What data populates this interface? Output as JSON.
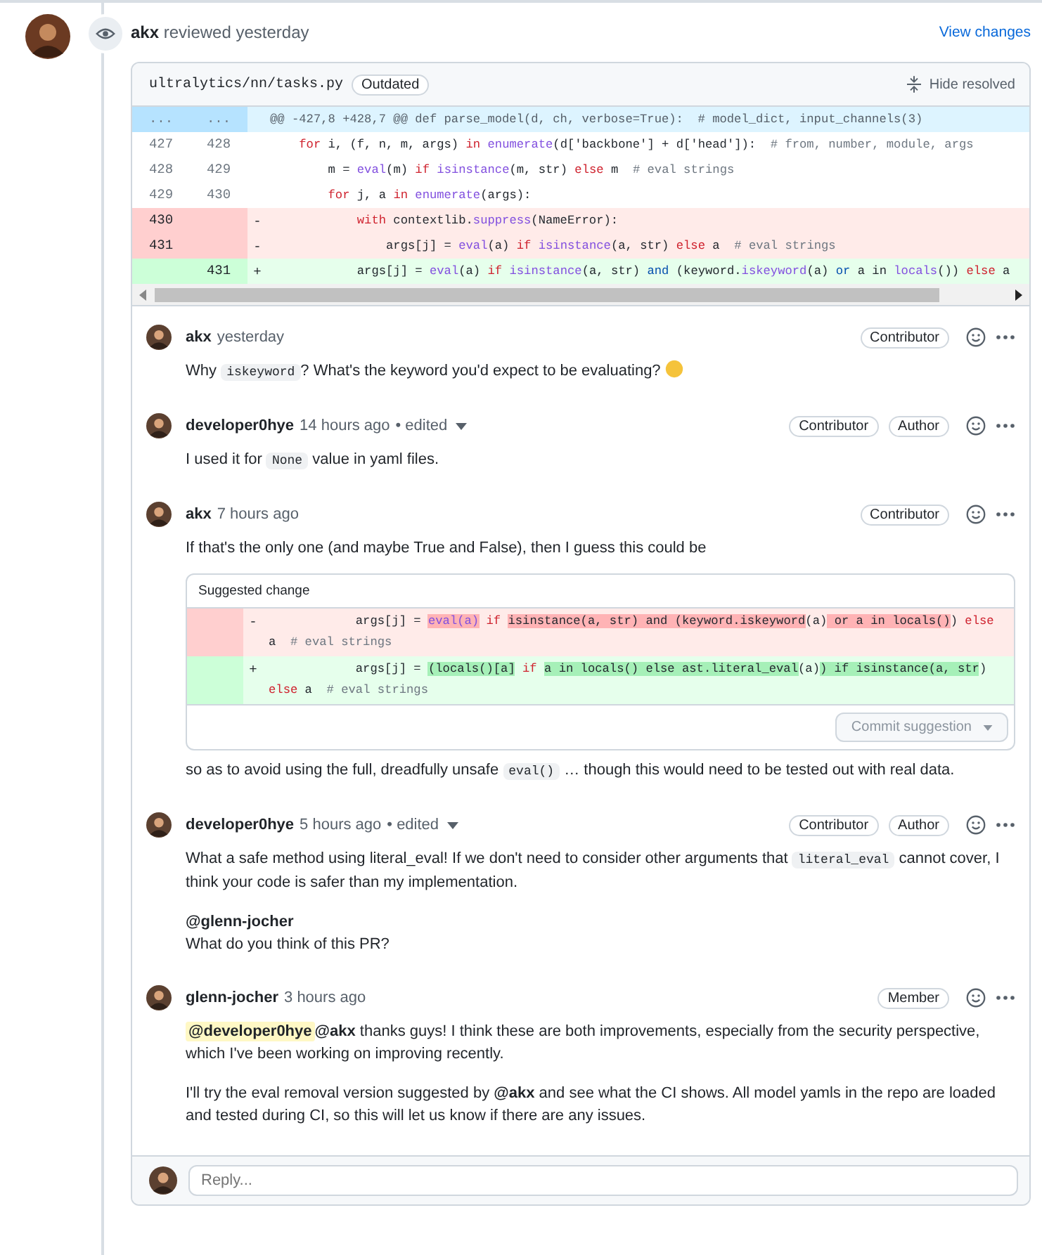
{
  "review": {
    "author": "akx",
    "action": "reviewed yesterday",
    "view_changes": "View changes"
  },
  "file": {
    "path": "ultralytics/nn/tasks.py",
    "badge": "Outdated",
    "hide_resolved": "Hide resolved"
  },
  "diff": [
    {
      "kind": "hunk",
      "old": "...",
      "new": "...",
      "tokens": [
        {
          "text": "@@ -427,8 +428,7 @@ def parse_model(d, ch, verbose=True):  # model_dict, input_channels(3)",
          "kind": "plain"
        }
      ]
    },
    {
      "kind": "context",
      "old": "427",
      "new": "428",
      "tokens": [
        {
          "text": "    for",
          "kind": "kw"
        },
        {
          "text": " i, (f, n, m, args) ",
          "kind": "plain"
        },
        {
          "text": "in ",
          "kind": "kw"
        },
        {
          "text": "enumerate",
          "kind": "fn"
        },
        {
          "text": "(d['backbone'] + d['head']):  ",
          "kind": "plain"
        },
        {
          "text": "# from, number, module, args",
          "kind": "cm"
        }
      ]
    },
    {
      "kind": "context",
      "old": "428",
      "new": "429",
      "tokens": [
        {
          "text": "        m = ",
          "kind": "plain"
        },
        {
          "text": "eval",
          "kind": "fn"
        },
        {
          "text": "(m) ",
          "kind": "plain"
        },
        {
          "text": "if ",
          "kind": "kw"
        },
        {
          "text": "isinstance",
          "kind": "fn"
        },
        {
          "text": "(m, str) ",
          "kind": "plain"
        },
        {
          "text": "else",
          "kind": "kw"
        },
        {
          "text": " m  ",
          "kind": "plain"
        },
        {
          "text": "# eval strings",
          "kind": "cm"
        }
      ]
    },
    {
      "kind": "context",
      "old": "429",
      "new": "430",
      "tokens": [
        {
          "text": "        for",
          "kind": "kw"
        },
        {
          "text": " j, a ",
          "kind": "plain"
        },
        {
          "text": "in ",
          "kind": "kw"
        },
        {
          "text": "enumerate",
          "kind": "fn"
        },
        {
          "text": "(args):",
          "kind": "plain"
        }
      ]
    },
    {
      "kind": "del",
      "old": "430",
      "sign": "-",
      "tokens": [
        {
          "text": "            with",
          "kind": "kw"
        },
        {
          "text": " contextlib.",
          "kind": "plain"
        },
        {
          "text": "suppress",
          "kind": "fn"
        },
        {
          "text": "(NameError):",
          "kind": "plain"
        }
      ]
    },
    {
      "kind": "del",
      "old": "431",
      "sign": "-",
      "tokens": [
        {
          "text": "                args[j] = ",
          "kind": "plain"
        },
        {
          "text": "eval",
          "kind": "fn"
        },
        {
          "text": "(a) ",
          "kind": "plain"
        },
        {
          "text": "if ",
          "kind": "kw"
        },
        {
          "text": "isinstance",
          "kind": "fn"
        },
        {
          "text": "(a, str) ",
          "kind": "plain"
        },
        {
          "text": "else",
          "kind": "kw"
        },
        {
          "text": " a  ",
          "kind": "plain"
        },
        {
          "text": "# eval strings",
          "kind": "cm"
        }
      ]
    },
    {
      "kind": "add",
      "new": "431",
      "sign": "+",
      "tokens": [
        {
          "text": "            args[j] = ",
          "kind": "plain"
        },
        {
          "text": "eval",
          "kind": "fn"
        },
        {
          "text": "(a) ",
          "kind": "plain"
        },
        {
          "text": "if ",
          "kind": "kw"
        },
        {
          "text": "isinstance",
          "kind": "fn"
        },
        {
          "text": "(a, str) ",
          "kind": "plain"
        },
        {
          "text": "and",
          "kind": "op"
        },
        {
          "text": " (keyword.",
          "kind": "plain"
        },
        {
          "text": "iskeyword",
          "kind": "fn"
        },
        {
          "text": "(a) ",
          "kind": "plain"
        },
        {
          "text": "or",
          "kind": "op"
        },
        {
          "text": " a in ",
          "kind": "plain"
        },
        {
          "text": "locals",
          "kind": "fn"
        },
        {
          "text": "()) ",
          "kind": "plain"
        },
        {
          "text": "else",
          "kind": "kw"
        },
        {
          "text": " a",
          "kind": "plain"
        }
      ]
    }
  ],
  "comments": [
    {
      "author": "akx",
      "time": "yesterday",
      "badges": [
        "Contributor"
      ],
      "body": [
        {
          "kind": "paragraph",
          "segments": [
            {
              "kind": "text",
              "text": "Why "
            },
            {
              "kind": "code",
              "text": "iskeyword"
            },
            {
              "kind": "text",
              "text": "? What's the keyword you'd expect to be evaluating? "
            },
            {
              "kind": "emoji"
            }
          ]
        }
      ]
    },
    {
      "author": "developer0hye",
      "time": "14 hours ago",
      "edited_label": "• edited",
      "badges": [
        "Contributor",
        "Author"
      ],
      "body": [
        {
          "kind": "paragraph",
          "segments": [
            {
              "kind": "text",
              "text": "I used it for "
            },
            {
              "kind": "code",
              "text": "None"
            },
            {
              "kind": "text",
              "text": " value in yaml files."
            }
          ]
        }
      ]
    },
    {
      "author": "akx",
      "time": "7 hours ago",
      "badges": [
        "Contributor"
      ],
      "body": [
        {
          "kind": "paragraph",
          "segments": [
            {
              "kind": "text",
              "text": "If that's the only one (and maybe True and False), then I guess this could be"
            }
          ]
        },
        {
          "kind": "suggestion",
          "title": "Suggested change",
          "button": {
            "label": "Commit suggestion",
            "disabled": true
          },
          "lines": [
            {
              "kind": "del",
              "sign": "-",
              "tokens": [
                {
                  "text": "            args[j] = ",
                  "kind": "plain",
                  "highlighted": false
                },
                {
                  "text": "eval(a)",
                  "kind": "fn",
                  "highlighted": true
                },
                {
                  "text": " if ",
                  "kind": "kw",
                  "highlighted": false
                },
                {
                  "text": "isinstance(a, str) and (keyword.iskeyword",
                  "kind": "plain",
                  "highlighted": true
                },
                {
                  "text": "(a)",
                  "kind": "plain",
                  "highlighted": false
                },
                {
                  "text": " or a in locals()",
                  "kind": "plain",
                  "highlighted": true
                },
                {
                  "text": ") ",
                  "kind": "plain",
                  "highlighted": false
                },
                {
                  "text": "else",
                  "kind": "kw",
                  "highlighted": false
                },
                {
                  "text": " a  ",
                  "kind": "plain",
                  "highlighted": false
                },
                {
                  "text": "# eval strings",
                  "kind": "cm",
                  "highlighted": false
                }
              ]
            },
            {
              "kind": "add",
              "sign": "+",
              "tokens": [
                {
                  "text": "            args[j] = ",
                  "kind": "plain",
                  "highlighted": false
                },
                {
                  "text": "(locals()[a]",
                  "kind": "plain",
                  "highlighted": true
                },
                {
                  "text": " if ",
                  "kind": "kw",
                  "highlighted": false
                },
                {
                  "text": "a in locals() else ast.literal_eval",
                  "kind": "plain",
                  "highlighted": true
                },
                {
                  "text": "(a)",
                  "kind": "plain",
                  "highlighted": false
                },
                {
                  "text": ") if isinstance(a, str",
                  "kind": "plain",
                  "highlighted": true
                },
                {
                  "text": ") ",
                  "kind": "plain",
                  "highlighted": false
                },
                {
                  "text": "else",
                  "kind": "kw",
                  "highlighted": false
                },
                {
                  "text": " a  ",
                  "kind": "plain",
                  "highlighted": false
                },
                {
                  "text": "# eval strings",
                  "kind": "cm",
                  "highlighted": false
                }
              ]
            }
          ]
        },
        {
          "kind": "paragraph",
          "segments": [
            {
              "kind": "text",
              "text": "so as to avoid using the full, dreadfully unsafe "
            },
            {
              "kind": "code",
              "text": "eval()"
            },
            {
              "kind": "text",
              "text": " … though this would need to be tested out with real data."
            }
          ]
        }
      ]
    },
    {
      "author": "developer0hye",
      "time": "5 hours ago",
      "edited_label": "• edited",
      "badges": [
        "Contributor",
        "Author"
      ],
      "body": [
        {
          "kind": "paragraph",
          "segments": [
            {
              "kind": "text",
              "text": "What a safe method using literal_eval! If we don't need to consider other arguments that "
            },
            {
              "kind": "code",
              "text": "literal_eval"
            },
            {
              "kind": "text",
              "text": " cannot cover, I think your code is safer than my implementation."
            }
          ]
        },
        {
          "kind": "paragraph",
          "segments": [
            {
              "kind": "mention",
              "text": "@glenn-jocher"
            }
          ]
        },
        {
          "kind": "line",
          "segments": [
            {
              "kind": "text",
              "text": "What do you think of this PR?"
            }
          ]
        }
      ]
    },
    {
      "author": "glenn-jocher",
      "time": "3 hours ago",
      "badges": [
        "Member"
      ],
      "body": [
        {
          "kind": "paragraph",
          "segments": [
            {
              "kind": "self-mention",
              "text": "@developer0hye"
            },
            {
              "kind": "mention",
              "text": "@akx"
            },
            {
              "kind": "text",
              "text": " thanks guys! I think these are both improvements, especially from the security perspective, which I've been working on improving recently."
            }
          ]
        },
        {
          "kind": "paragraph",
          "segments": [
            {
              "kind": "text",
              "text": "I'll try the eval removal version suggested by "
            },
            {
              "kind": "mention",
              "text": "@akx"
            },
            {
              "kind": "text",
              "text": " and see what the CI shows. All model yamls in the repo are loaded and tested during CI, so this will let us know if there are any issues."
            }
          ]
        }
      ]
    }
  ],
  "reply": {
    "placeholder": "Reply..."
  }
}
